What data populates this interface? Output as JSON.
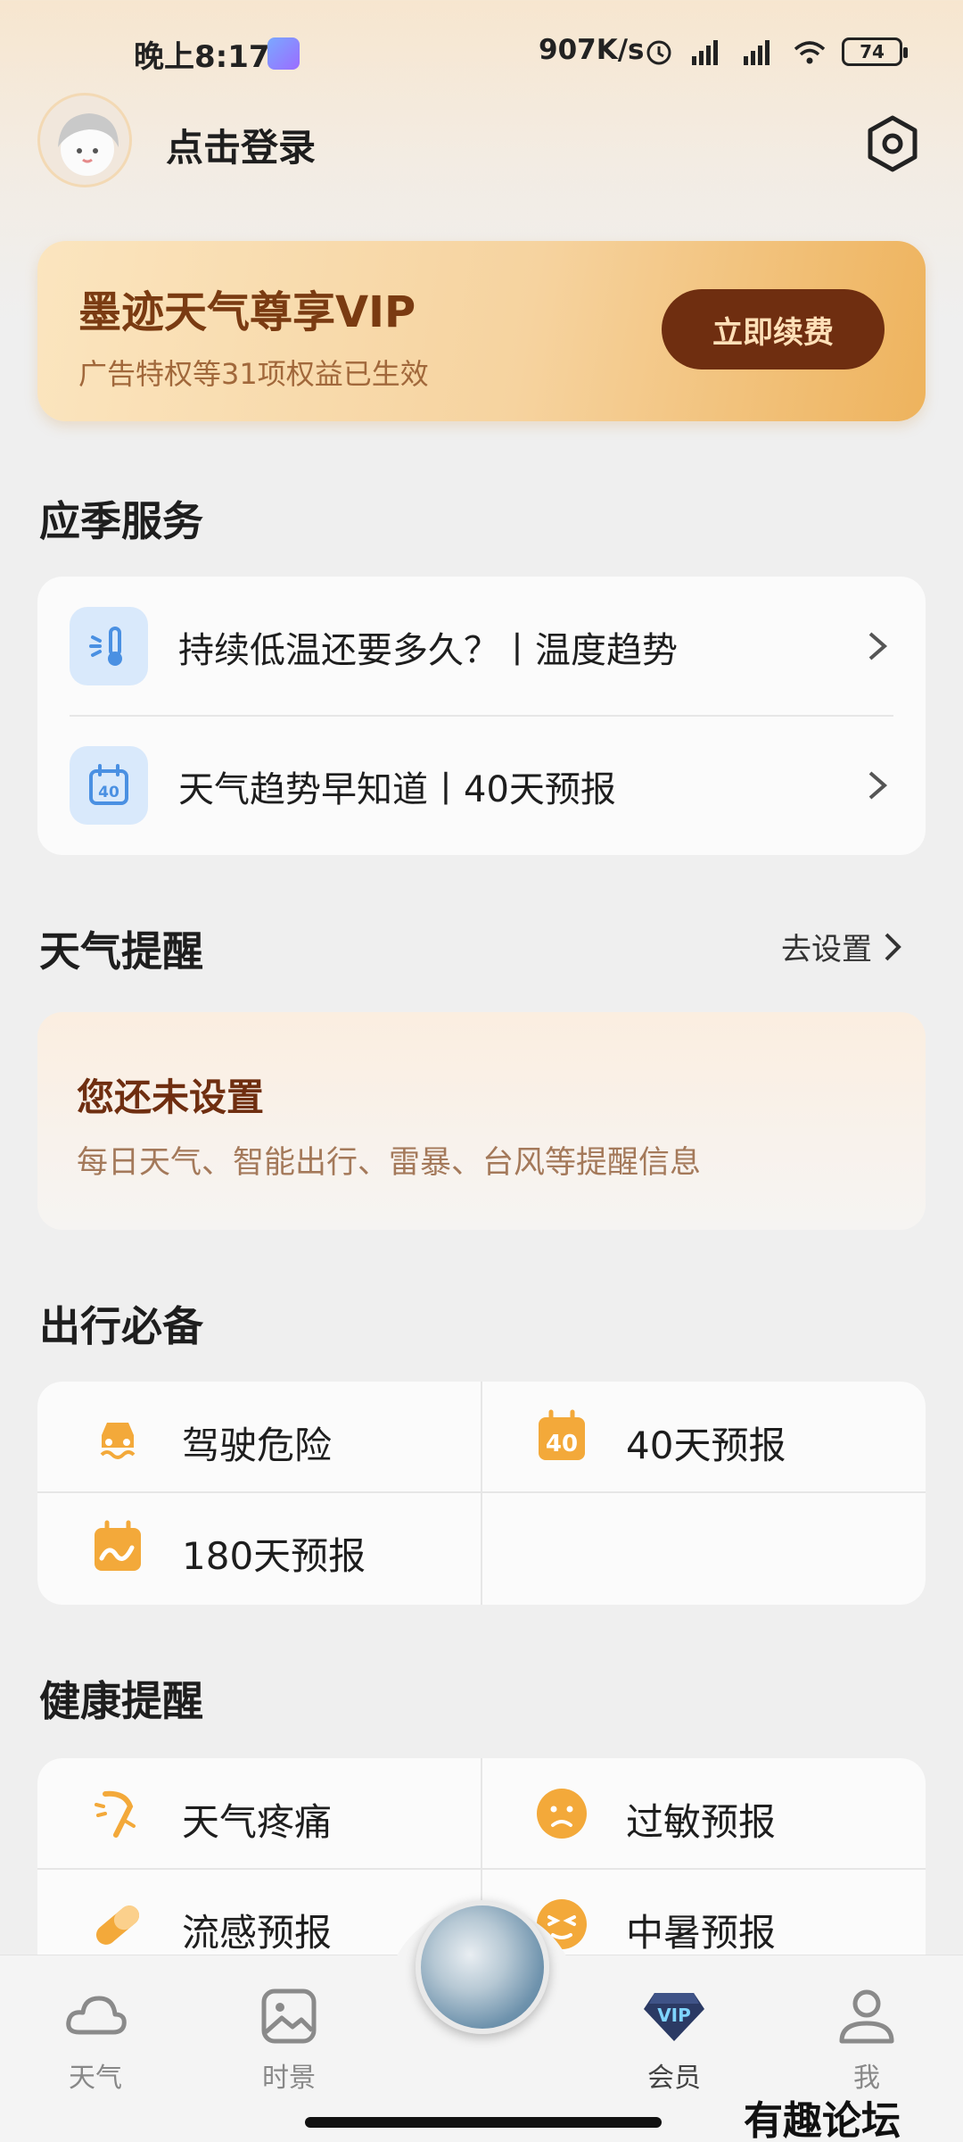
{
  "status_bar": {
    "time": "晚上8:17",
    "net_speed": "907K/s",
    "battery": "74"
  },
  "header": {
    "login_text": "点击登录"
  },
  "vip": {
    "title": "墨迹天气尊享VIP",
    "subtitle": "广告特权等31项权益已生效",
    "button": "立即续费"
  },
  "seasonal": {
    "title": "应季服务",
    "items": [
      {
        "label": "持续低温还要多久？丨温度趋势",
        "icon": "thermometer-icon"
      },
      {
        "label": "天气趋势早知道丨40天预报",
        "icon": "calendar-40-icon"
      }
    ]
  },
  "weather_remind": {
    "title": "天气提醒",
    "action": "去设置",
    "card_title": "您还未设置",
    "card_subtitle": "每日天气、智能出行、雷暴、台风等提醒信息"
  },
  "travel": {
    "title": "出行必备",
    "items": [
      {
        "label": "驾驶危险",
        "icon": "car-danger-icon"
      },
      {
        "label": "40天预报",
        "icon": "calendar-40-icon"
      },
      {
        "label": "180天预报",
        "icon": "calendar-trend-icon"
      }
    ],
    "calendar_number": "40"
  },
  "health": {
    "title": "健康提醒",
    "items": [
      {
        "label": "天气疼痛",
        "icon": "joint-pain-icon"
      },
      {
        "label": "过敏预报",
        "icon": "allergy-face-icon"
      },
      {
        "label": "流感预报",
        "icon": "pill-icon"
      },
      {
        "label": "中暑预报",
        "icon": "heatstroke-face-icon"
      }
    ]
  },
  "bottom_nav": {
    "items": [
      {
        "label": "天气",
        "icon": "cloud-icon"
      },
      {
        "label": "时景",
        "icon": "picture-icon"
      },
      {
        "label": "会员",
        "icon": "vip-diamond-icon",
        "badge": "VIP"
      },
      {
        "label": "我",
        "icon": "person-icon"
      }
    ]
  },
  "watermark": "有趣论坛",
  "colors": {
    "accent_dark": "#6f2e10",
    "vip_gold": "#f6d39f",
    "icon_orange": "#f3a93a",
    "icon_blue": "#4a90e2"
  }
}
